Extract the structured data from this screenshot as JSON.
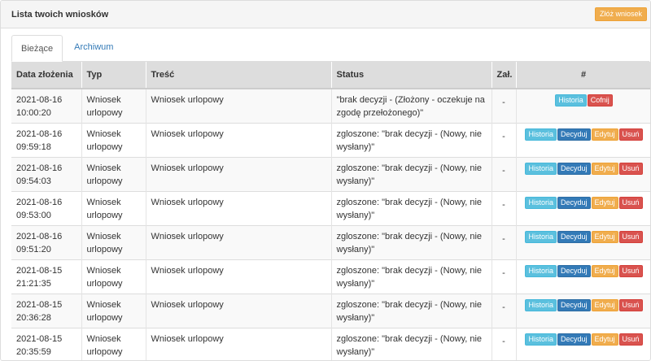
{
  "header": {
    "title": "Lista twoich wniosków",
    "new_request_label": "Złóż wniosek"
  },
  "tabs": [
    {
      "label": "Bieżące",
      "active": true
    },
    {
      "label": "Archiwum",
      "active": false
    }
  ],
  "table": {
    "columns": [
      "Data złożenia",
      "Typ",
      "Treść",
      "Status",
      "Zał.",
      "#"
    ],
    "action_labels": {
      "history": "Historia",
      "withdraw": "Cofnij",
      "decide": "Decyduj",
      "edit": "Edytuj",
      "delete": "Usuń"
    },
    "rows": [
      {
        "date": "2021-08-16",
        "time": "10:00:20",
        "type_l1": "Wniosek",
        "type_l2": "urlopowy",
        "content": "Wniosek urlopowy",
        "status_l1": "\"brak decyzji - (Złożony - oczekuje na",
        "status_l2": "zgodę przełożonego)\"",
        "att": "-",
        "actions": [
          "history",
          "withdraw"
        ]
      },
      {
        "date": "2021-08-16",
        "time": "09:59:18",
        "type_l1": "Wniosek",
        "type_l2": "urlopowy",
        "content": "Wniosek urlopowy",
        "status_l1": "zgloszone: \"brak decyzji - (Nowy, nie",
        "status_l2": "wysłany)\"",
        "att": "-",
        "actions": [
          "history",
          "decide",
          "edit",
          "delete"
        ]
      },
      {
        "date": "2021-08-16",
        "time": "09:54:03",
        "type_l1": "Wniosek",
        "type_l2": "urlopowy",
        "content": "Wniosek urlopowy",
        "status_l1": "zgloszone: \"brak decyzji - (Nowy, nie",
        "status_l2": "wysłany)\"",
        "att": "-",
        "actions": [
          "history",
          "decide",
          "edit",
          "delete"
        ]
      },
      {
        "date": "2021-08-16",
        "time": "09:53:00",
        "type_l1": "Wniosek",
        "type_l2": "urlopowy",
        "content": "Wniosek urlopowy",
        "status_l1": "zgloszone: \"brak decyzji - (Nowy, nie",
        "status_l2": "wysłany)\"",
        "att": "-",
        "actions": [
          "history",
          "decide",
          "edit",
          "delete"
        ]
      },
      {
        "date": "2021-08-16",
        "time": "09:51:20",
        "type_l1": "Wniosek",
        "type_l2": "urlopowy",
        "content": "Wniosek urlopowy",
        "status_l1": "zgloszone: \"brak decyzji - (Nowy, nie",
        "status_l2": "wysłany)\"",
        "att": "-",
        "actions": [
          "history",
          "decide",
          "edit",
          "delete"
        ]
      },
      {
        "date": "2021-08-15",
        "time": "21:21:35",
        "type_l1": "Wniosek",
        "type_l2": "urlopowy",
        "content": "Wniosek urlopowy",
        "status_l1": "zgloszone: \"brak decyzji - (Nowy, nie",
        "status_l2": "wysłany)\"",
        "att": "-",
        "actions": [
          "history",
          "decide",
          "edit",
          "delete"
        ]
      },
      {
        "date": "2021-08-15",
        "time": "20:36:28",
        "type_l1": "Wniosek",
        "type_l2": "urlopowy",
        "content": "Wniosek urlopowy",
        "status_l1": "zgloszone: \"brak decyzji - (Nowy, nie",
        "status_l2": "wysłany)\"",
        "att": "-",
        "actions": [
          "history",
          "decide",
          "edit",
          "delete"
        ]
      },
      {
        "date": "2021-08-15",
        "time": "20:35:59",
        "type_l1": "Wniosek",
        "type_l2": "urlopowy",
        "content": "Wniosek urlopowy",
        "status_l1": "zgloszone: \"brak decyzji - (Nowy, nie",
        "status_l2": "wysłany)\"",
        "att": "-",
        "actions": [
          "history",
          "decide",
          "edit",
          "delete"
        ]
      }
    ]
  }
}
